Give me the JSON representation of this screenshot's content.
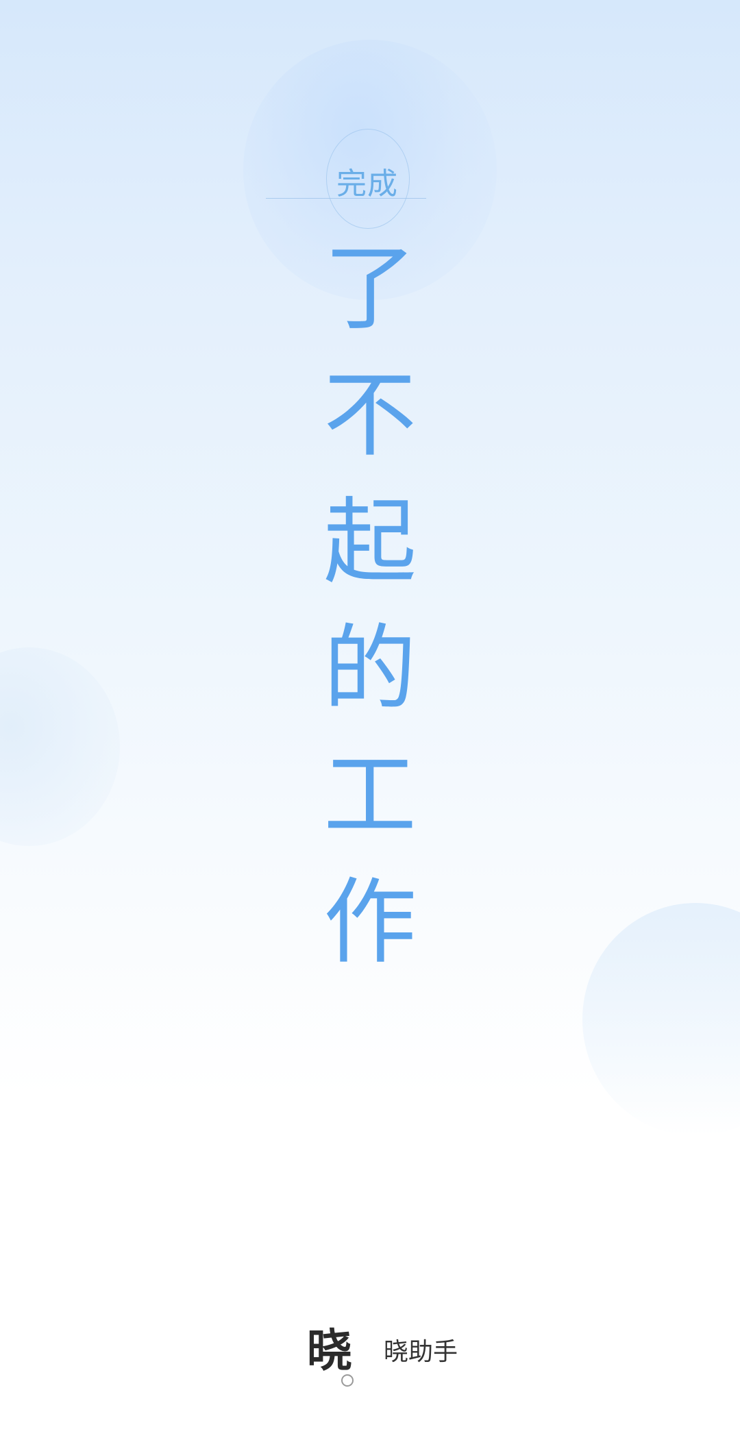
{
  "headline": {
    "badge": "完成",
    "characters": [
      "了",
      "不",
      "起",
      "的",
      "工",
      "作"
    ]
  },
  "brand": {
    "mark": "晓",
    "name": "晓助手"
  },
  "colors": {
    "accent": "#5aa3ec",
    "badge_text": "#6aaee8",
    "brand_text": "#333333",
    "background_top": "#d6e8fb",
    "background_bottom": "#ffffff"
  }
}
